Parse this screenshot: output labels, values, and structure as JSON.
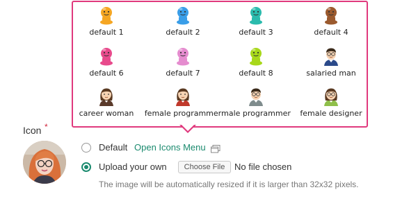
{
  "icon_menu": {
    "items": [
      {
        "label": "default 1",
        "icon": "default-avatar-icon",
        "color": "#f5a623"
      },
      {
        "label": "default 2",
        "icon": "default-avatar-icon",
        "color": "#3a9ee8"
      },
      {
        "label": "default 3",
        "icon": "default-avatar-icon",
        "color": "#2bbbad"
      },
      {
        "label": "default 4",
        "icon": "default-avatar-icon",
        "color": "#9b5a2e"
      },
      {
        "label": "default 6",
        "icon": "default-avatar-icon",
        "color": "#e84a8c"
      },
      {
        "label": "default 7",
        "icon": "default-avatar-icon",
        "color": "#e58ccf"
      },
      {
        "label": "default 8",
        "icon": "default-avatar-icon",
        "color": "#a8d81a"
      },
      {
        "label": "salaried man",
        "icon": "salaried-man-icon",
        "color": "#2b4a8a"
      },
      {
        "label": "career woman",
        "icon": "career-woman-icon",
        "color": "#5a3a2a"
      },
      {
        "label": "female programmer",
        "icon": "female-programmer-icon",
        "color": "#c0392b"
      },
      {
        "label": "male programmer",
        "icon": "male-programmer-icon",
        "color": "#7f8c8d"
      },
      {
        "label": "female designer",
        "icon": "female-designer-icon",
        "color": "#8fbf4a"
      }
    ]
  },
  "form": {
    "icon_label": "Icon",
    "required_mark": "*",
    "default_option": "Default",
    "open_menu_link": "Open Icons Menu",
    "upload_option": "Upload your own",
    "choose_file_button": "Choose File",
    "file_status": "No file chosen",
    "hint": "The image will be automatically resized if it is larger than 32x32 pixels.",
    "selected_option": "upload"
  },
  "colors": {
    "popup_border": "#e0397d",
    "accent": "#1a8a6e",
    "required": "#d0263d"
  }
}
